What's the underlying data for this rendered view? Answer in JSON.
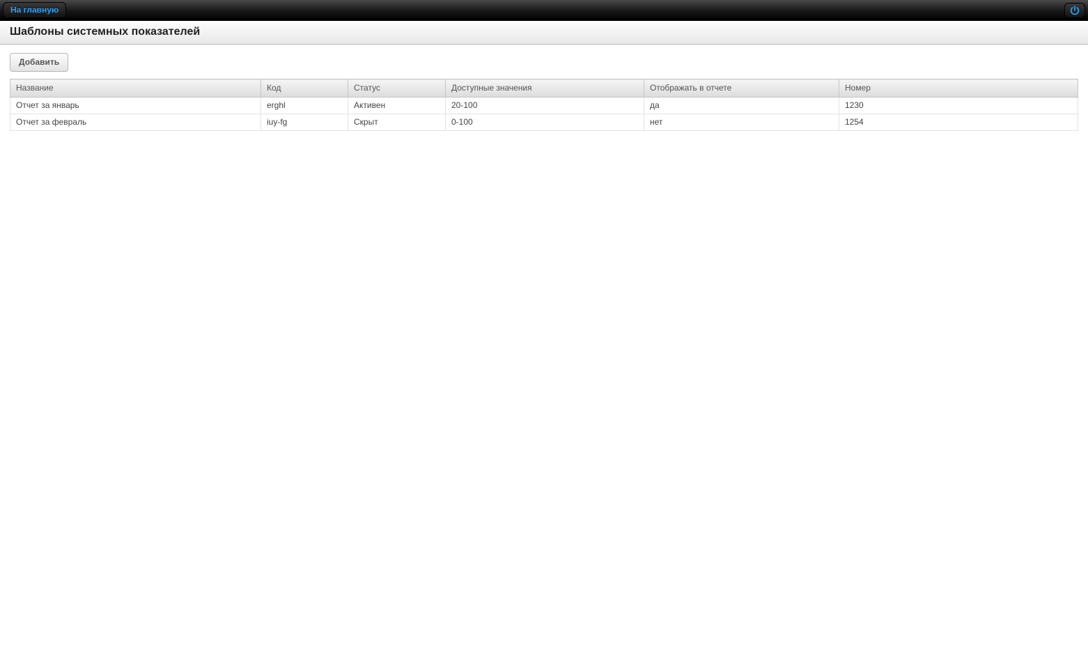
{
  "topbar": {
    "home_label": "На главную"
  },
  "page": {
    "title": "Шаблоны системных показателей"
  },
  "toolbar": {
    "add_label": "Добавить"
  },
  "table": {
    "headers": {
      "name": "Название",
      "code": "Код",
      "status": "Статус",
      "range": "Доступные значения",
      "report": "Отображать в отчете",
      "number": "Номер"
    },
    "rows": [
      {
        "name": "Отчет за январь",
        "code": "erghl",
        "status": "Активен",
        "range": "20-100",
        "report": "да",
        "number": "1230"
      },
      {
        "name": "Отчет за февраль",
        "code": "iuy-fg",
        "status": "Скрыт",
        "range": "0-100",
        "report": "нет",
        "number": "1254"
      }
    ]
  }
}
